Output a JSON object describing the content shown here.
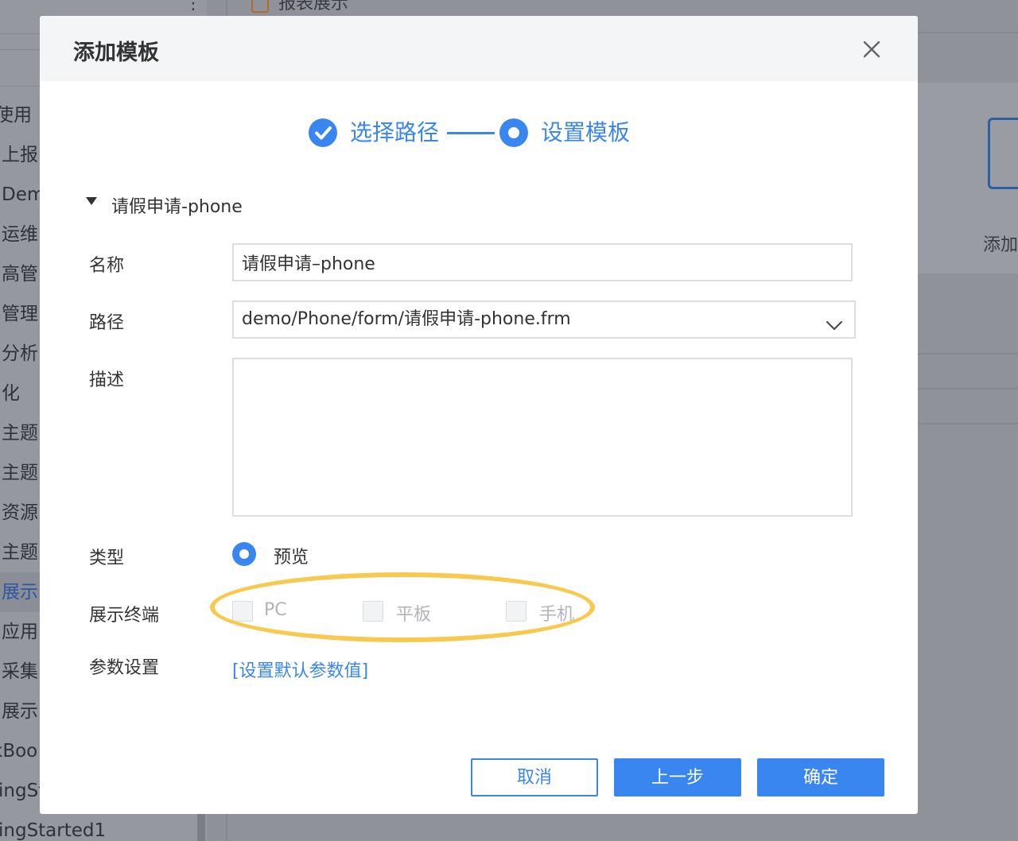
{
  "background": {
    "tab_label": "报表展示",
    "sidebar_items": [
      "使用",
      "上报",
      "Dem",
      "运维",
      "高管",
      "管理",
      "分析",
      "化",
      "主题",
      "主题",
      "资源",
      "主题",
      "展示",
      "应用",
      "采集",
      "展示",
      "kBoo",
      "ingSt",
      "ingStarted1"
    ],
    "active_item_index": 12,
    "card_label": "添加"
  },
  "dialog": {
    "title": "添加模板",
    "close_icon": "close-icon",
    "steps": [
      {
        "label": "选择路径",
        "state": "completed"
      },
      {
        "label": "设置模板",
        "state": "active"
      }
    ],
    "section_title": "请假申请-phone",
    "fields": {
      "name_label": "名称",
      "name_value": "请假申请–phone",
      "path_label": "路径",
      "path_value": "demo/Phone/form/请假申请-phone.frm",
      "desc_label": "描述",
      "desc_value": "",
      "type_label": "类型",
      "type_option": "预览",
      "terminal_label": "展示终端",
      "terminal_options": [
        "PC",
        "平板",
        "手机"
      ],
      "param_label": "参数设置",
      "param_link": "[设置默认参数值]"
    },
    "buttons": {
      "cancel": "取消",
      "prev": "上一步",
      "ok": "确定"
    },
    "colors": {
      "accent": "#3a86f0",
      "highlight": "#f8c94e"
    }
  }
}
